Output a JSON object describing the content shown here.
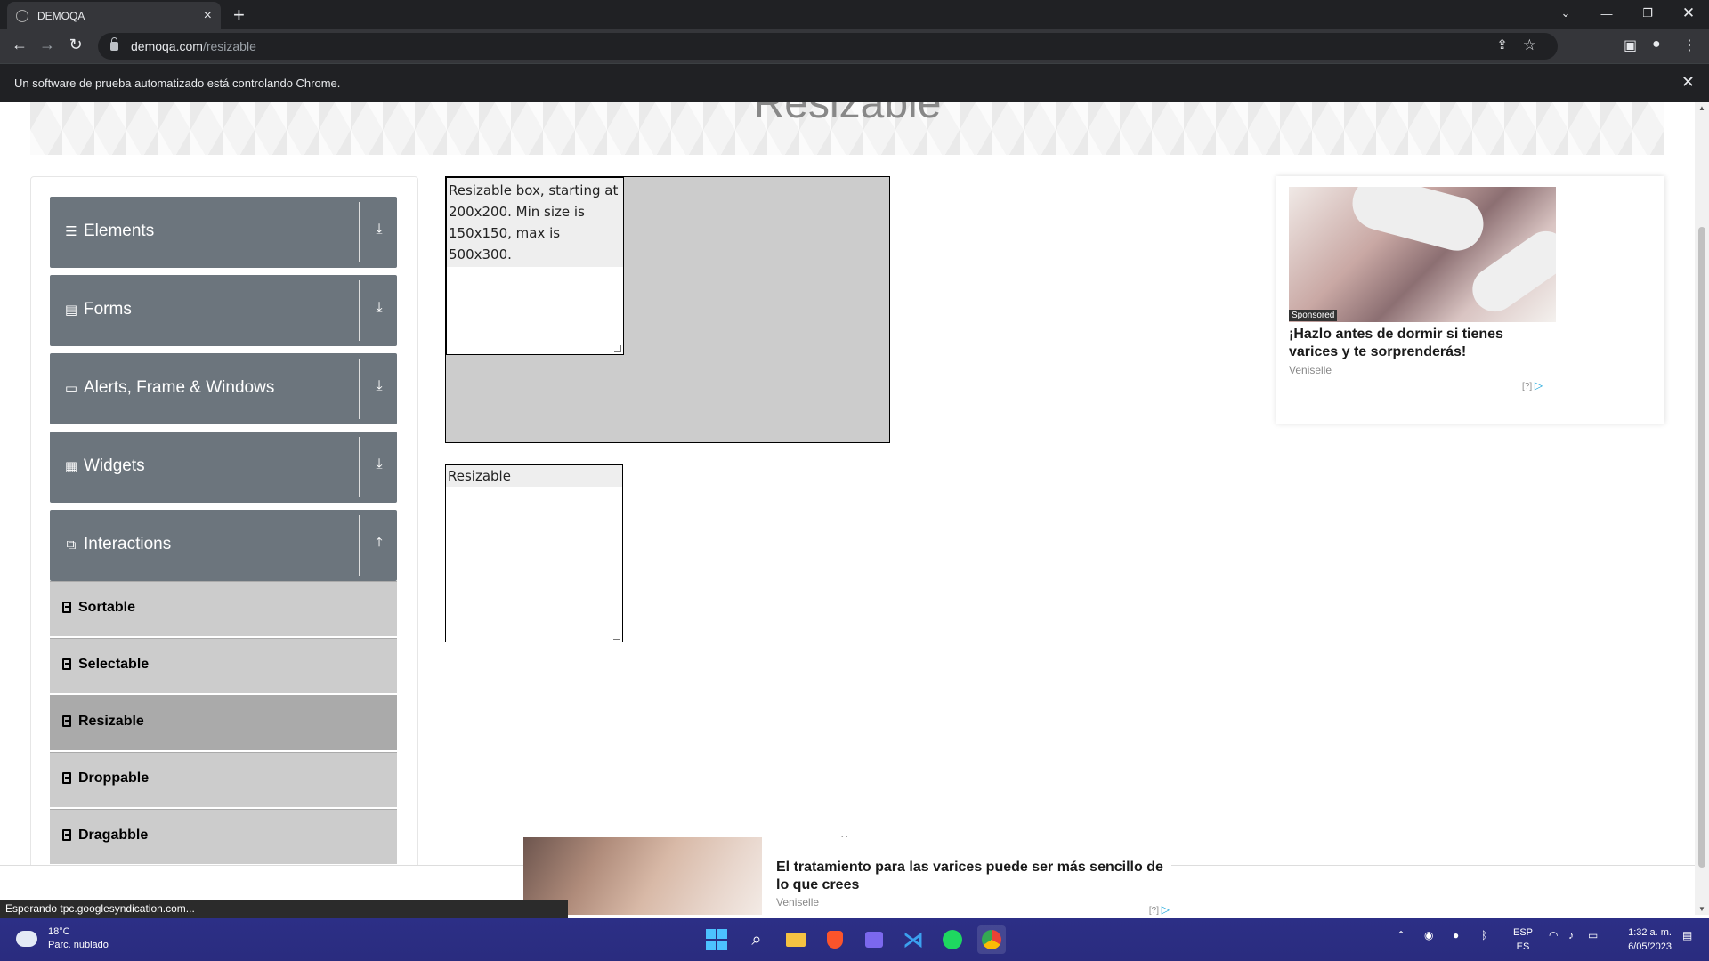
{
  "browser": {
    "tab_title": "DEMOQA",
    "url_host": "demoqa.com",
    "url_path": "/resizable",
    "infobar_message": "Un software de prueba automatizado está controlando Chrome."
  },
  "page": {
    "heading": "Resizable",
    "menu": {
      "groups": [
        {
          "label": "Elements",
          "icon": "hamburger-icon"
        },
        {
          "label": "Forms",
          "icon": "form-icon"
        },
        {
          "label": "Alerts, Frame & Windows",
          "icon": "window-icon"
        },
        {
          "label": "Widgets",
          "icon": "grid-icon"
        },
        {
          "label": "Interactions",
          "icon": "interactions-icon"
        }
      ],
      "items": [
        {
          "label": "Sortable"
        },
        {
          "label": "Selectable"
        },
        {
          "label": "Resizable",
          "active": true
        },
        {
          "label": "Droppable"
        },
        {
          "label": "Dragabble"
        }
      ]
    },
    "resizable_box_restricted": "Resizable box, starting at 200x200. Min size is 150x150, max is 500x300.",
    "resizable_box": "Resizable"
  },
  "ads": {
    "side": {
      "badge": "Sponsored",
      "headline": "¡Hazlo antes de dormir si tienes varices y te sorprenderás!",
      "advertiser": "Veniselle",
      "adchoices": "[?]"
    },
    "bottom": {
      "headline": "El tratamiento para las varices puede ser más sencillo de lo que crees",
      "advertiser": "Veniselle",
      "adchoices": "[?]"
    }
  },
  "status_bar": "Esperando tpc.googlesyndication.com...",
  "taskbar": {
    "weather_temp": "18°C",
    "weather_desc": "Parc. nublado",
    "lang_top": "ESP",
    "lang_bottom": "ES",
    "time": "1:32 a. m.",
    "date": "6/05/2023"
  },
  "colors": {
    "menu_group_bg": "#6c757d",
    "menu_item_bg": "#cccccc",
    "menu_item_active_bg": "#aaaaaa",
    "taskbar_bg": "#2a2d8c"
  }
}
